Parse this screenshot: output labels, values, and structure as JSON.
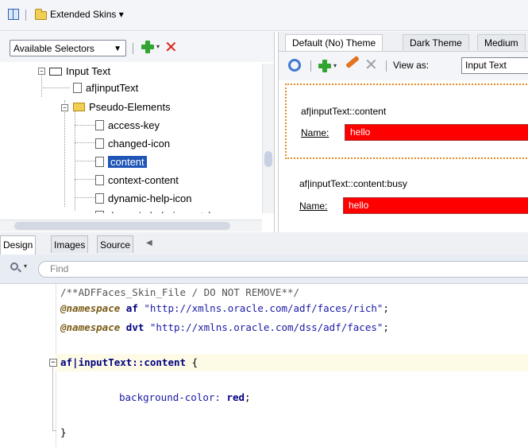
{
  "topbar": {
    "title": "Extended Skins",
    "title_arrow": "▾"
  },
  "selectors": {
    "dropdown_label": "Available Selectors",
    "dropdown_arrow": "▼",
    "add_arrow": "▾",
    "remove_glyph": "✕"
  },
  "tree": {
    "items": [
      {
        "label": "Input Text",
        "expander": "−"
      },
      {
        "label": "af|inputText"
      },
      {
        "label": "Pseudo-Elements",
        "expander": "−"
      },
      {
        "label": "access-key"
      },
      {
        "label": "changed-icon"
      },
      {
        "label": "content"
      },
      {
        "label": "context-content"
      },
      {
        "label": "dynamic-help-icon"
      },
      {
        "label": "dynamic-help-icon-style"
      }
    ],
    "selected_index": 5
  },
  "preview": {
    "tabs": [
      "Default (No) Theme",
      "Dark Theme",
      "Medium"
    ],
    "add_arrow": "▾",
    "remove_glyph": "✕",
    "view_as_label": "View as:",
    "view_as_value": "Input Text",
    "boxes": [
      {
        "selector": "af|inputText::content",
        "field_label": "Name:",
        "field_value": "hello"
      },
      {
        "selector": "af|inputText::content:busy",
        "field_label": "Name:",
        "field_value": "hello"
      }
    ]
  },
  "editor_tabs": [
    "Design",
    "Images",
    "Source"
  ],
  "editor_tabs_more": "◀",
  "find": {
    "placeholder": "Find",
    "drop_arrow": "▾"
  },
  "code": {
    "line1": "/**ADFFaces_Skin_File / DO NOT REMOVE**/",
    "ns1_kw": "@namespace",
    "ns1_prefix": "af",
    "ns1_url": "\"http://xmlns.oracle.com/adf/faces/rich\"",
    "ns2_kw": "@namespace",
    "ns2_prefix": "dvt",
    "ns2_url": "\"http://xmlns.oracle.com/dss/adf/faces\"",
    "semi": ";",
    "selector": "af|inputText::content",
    "brace_open": "{",
    "property": "background-color:",
    "value": "red",
    "brace_close": "}",
    "fold_glyph": "−"
  }
}
